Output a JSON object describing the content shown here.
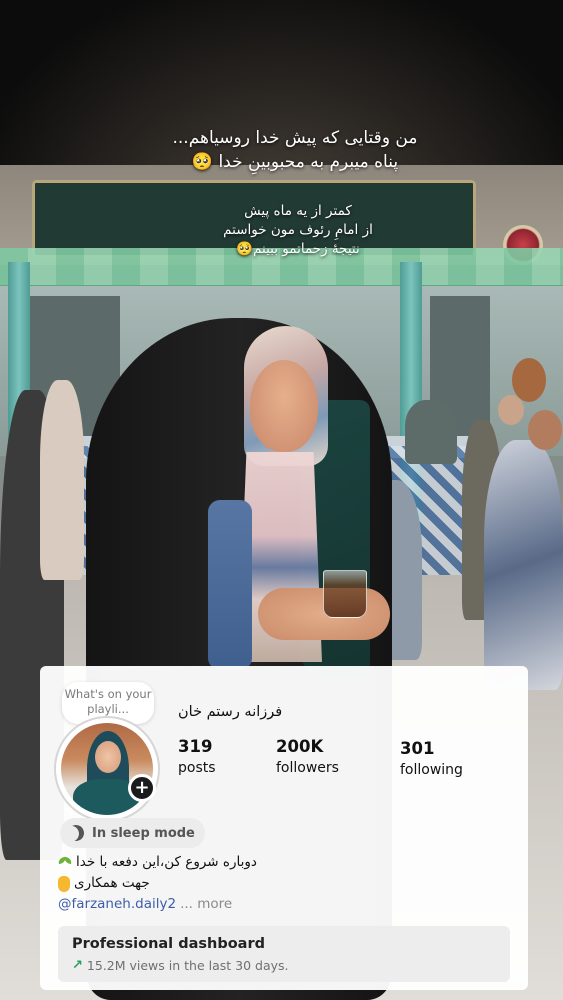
{
  "captions": {
    "block1": [
      "من وقتایی که پیش خدا روسیاهم...",
      "پناه میبرم به  محبوبینِ خدا 🥺"
    ],
    "block2": [
      "کمتر از یه ماه پیش",
      "از امامِ رئوف مون خواستم",
      "نتیجهٔ زحماتمو ببینم🥺"
    ]
  },
  "profile": {
    "note_placeholder": "What's on your playli...",
    "name": "فرزانه رستم خان",
    "stats": [
      {
        "value": "319",
        "label": "posts"
      },
      {
        "value": "200K",
        "label": "followers"
      },
      {
        "value": "301",
        "label": "following"
      }
    ],
    "status": "In sleep mode",
    "bio_lines": [
      "دوباره شروع کن،این دفعه با خدا",
      "جهت همکاری"
    ],
    "bio_link": "@farzaneh.daily2",
    "bio_more": "... more",
    "dashboard": {
      "title": "Professional dashboard",
      "subtitle": "15.2M views in the last 30 days."
    }
  },
  "icons": {
    "status": "moon-icon",
    "add_story": "plus-icon",
    "trend": "trend-up-icon",
    "bio_emojis": [
      "sprout-emoji",
      "pointing-down-emoji"
    ]
  },
  "colors": {
    "link": "#3c5ea8",
    "trend": "#2a9d5a"
  }
}
